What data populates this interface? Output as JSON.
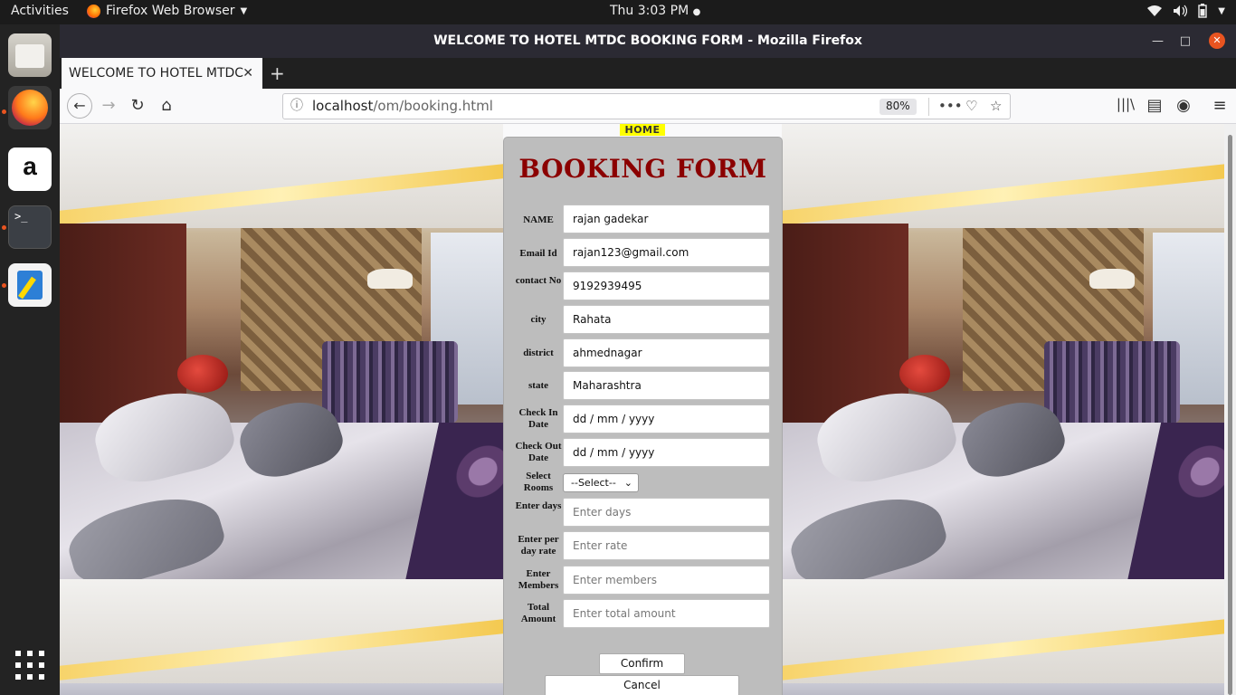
{
  "gnome": {
    "activities": "Activities",
    "app_name": "Firefox Web Browser",
    "clock": "Thu  3:03 PM"
  },
  "dock": {
    "items": [
      "files-icon",
      "firefox-icon",
      "amazon-icon",
      "terminal-icon",
      "text-editor-icon",
      "app-grid-icon"
    ],
    "terminal_glyph": ">_",
    "amazon_glyph": "a"
  },
  "window": {
    "title": "WELCOME TO HOTEL MTDC BOOKING FORM - Mozilla Firefox"
  },
  "tab": {
    "label": "WELCOME TO HOTEL MTDC",
    "close": "✕",
    "new_tab": "+"
  },
  "urlbar": {
    "host": "localhost",
    "path": "/om/booking.html",
    "zoom": "80%"
  },
  "page": {
    "home_link": "HOME",
    "form_title": "BOOKING FORM",
    "fields": [
      {
        "label": "NAME",
        "value": "rajan gadekar",
        "placeholder": ""
      },
      {
        "label": "Email Id",
        "value": "rajan123@gmail.com",
        "placeholder": ""
      },
      {
        "label": "contact No",
        "value": "9192939495",
        "placeholder": ""
      },
      {
        "label": "city",
        "value": "Rahata",
        "placeholder": ""
      },
      {
        "label": "district",
        "value": "ahmednagar",
        "placeholder": ""
      },
      {
        "label": "state",
        "value": "Maharashtra",
        "placeholder": ""
      },
      {
        "label": "Check In Date",
        "value": "dd / mm / yyyy",
        "placeholder": ""
      },
      {
        "label": "Check Out Date",
        "value": "dd / mm / yyyy",
        "placeholder": ""
      },
      {
        "label": "Select Rooms",
        "value": "--Select--",
        "placeholder": ""
      },
      {
        "label": "Enter days",
        "value": "",
        "placeholder": "Enter days"
      },
      {
        "label": "Enter per day rate",
        "value": "",
        "placeholder": "Enter rate"
      },
      {
        "label": "Enter Members",
        "value": "",
        "placeholder": "Enter members"
      },
      {
        "label": "Total Amount",
        "value": "",
        "placeholder": "Enter total amount"
      }
    ],
    "confirm_label": "Confirm",
    "cancel_label": "Cancel"
  }
}
